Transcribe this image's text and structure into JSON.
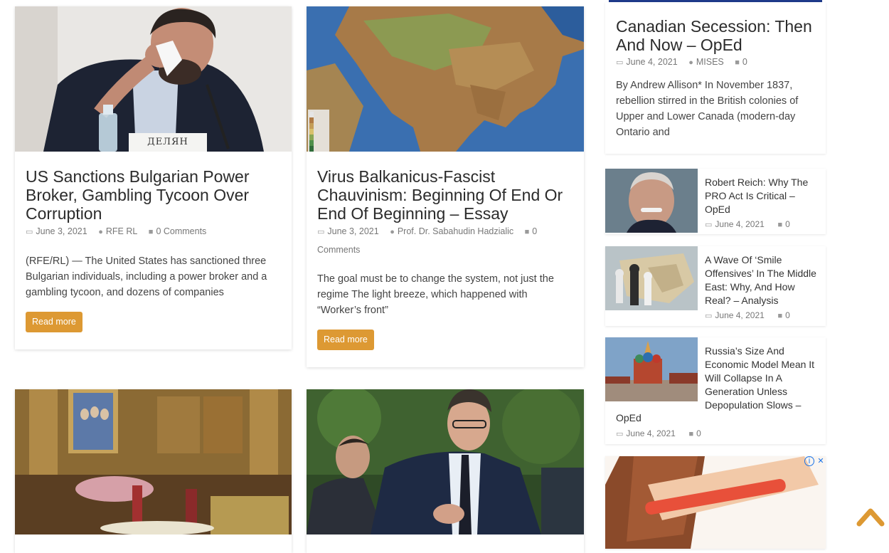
{
  "posts": [
    {
      "title": "US Sanctions Bulgarian Power Broker, Gambling Tycoon Over Corruption",
      "date": "June 3, 2021",
      "author": "RFE RL",
      "comments": "0 Comments",
      "excerpt": "(RFE/RL) — The United States has sanctioned three Bulgarian individuals, including a power broker and a gambling tycoon, and dozens of companies",
      "read_more": "Read more",
      "image_sign": "ДЕЛЯН"
    },
    {
      "title": "Virus Balkanicus-Fascist Chauvinism: Beginning Of End Or End Of Beginning – Essay",
      "date": "June 3, 2021",
      "author": "Prof. Dr. Sabahudin Hadzialic",
      "comments_num": "0",
      "comments_word": "Comments",
      "excerpt": "The goal must be to change the system, not just the regime The light breeze, which happened with “Worker’s front”",
      "read_more": "Read more"
    }
  ],
  "sidebar": {
    "featured": {
      "title": "Canadian Secession: Then And Now – OpEd",
      "date": "June 4, 2021",
      "author": "MISES",
      "comments": "0",
      "excerpt": "By Andrew Allison* In November 1837, rebellion stirred in the British colonies of Upper and Lower Canada (modern-day Ontario and"
    },
    "items": [
      {
        "title": "Robert Reich: Why The PRO Act Is Critical – OpEd",
        "date": "June 4, 2021",
        "comments": "0"
      },
      {
        "title": "A Wave Of ‘Smile Offensives’ In The Middle East: Why, And How Real? – Analysis",
        "date": "June 4, 2021",
        "comments": "0"
      },
      {
        "title_wrap": "Russia’s Size And Economic Model Mean It Will Collapse In A Generation Unless Depopulation Slows –",
        "title_tail": "OpEd",
        "date": "June 4, 2021",
        "comments": "0"
      }
    ],
    "ad": {
      "info_icon": "i",
      "close_icon": "✕"
    }
  },
  "icons": {
    "calendar": "calendar-icon",
    "user": "user-icon",
    "comment": "comment-icon",
    "scroll_top": "chevron-up-icon"
  },
  "colors": {
    "button": "#dd9933",
    "sidebar_accent": "#1e3a8a",
    "scroll_top": "#dd9933"
  }
}
